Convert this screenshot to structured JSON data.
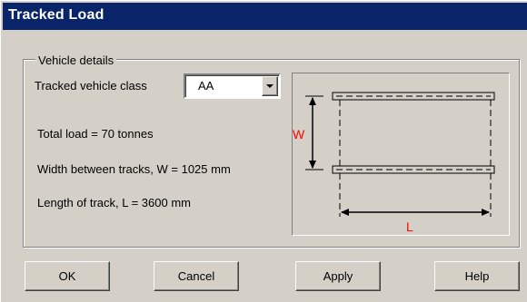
{
  "window": {
    "title": "Tracked Load"
  },
  "group": {
    "label": "Vehicle details",
    "class_label": "Tracked vehicle class",
    "class_value": "AA",
    "total_load": "Total load = 70 tonnes",
    "width_text": "Width between tracks, W = 1025 mm",
    "length_text": "Length of track, L = 3600 mm"
  },
  "diagram": {
    "w_label": "W",
    "l_label": "L",
    "label_color": "#ff0000"
  },
  "buttons": {
    "ok": "OK",
    "cancel": "Cancel",
    "apply": "Apply",
    "help": "Help"
  }
}
